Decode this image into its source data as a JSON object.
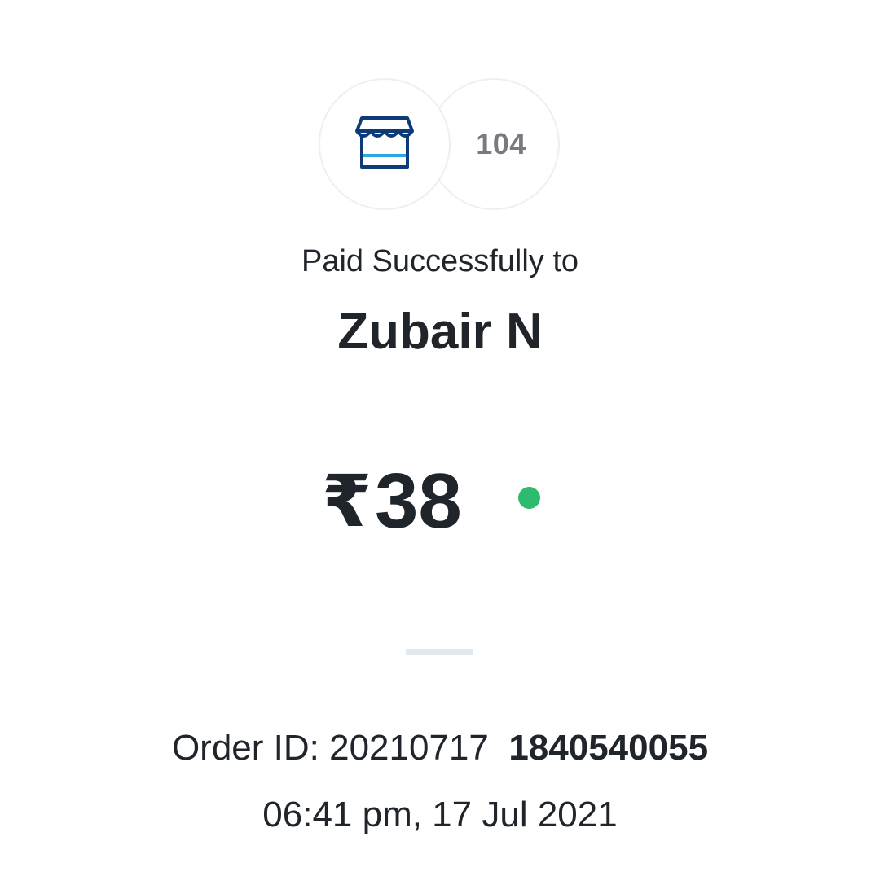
{
  "payee": {
    "count_badge": "104",
    "icon": "store-icon"
  },
  "status": {
    "paid_label": "Paid Successfully to",
    "payee_name": "Zubair N",
    "success_color": "#2dbb6e"
  },
  "amount": {
    "currency_symbol": "₹",
    "value": "38"
  },
  "order": {
    "prefix": "Order ID: 20210717",
    "suffix": "1840540055",
    "timestamp": "06:41 pm, 17 Jul 2021"
  },
  "colors": {
    "store_icon_primary": "#0d3b7a",
    "store_icon_accent": "#2aa7e0"
  }
}
